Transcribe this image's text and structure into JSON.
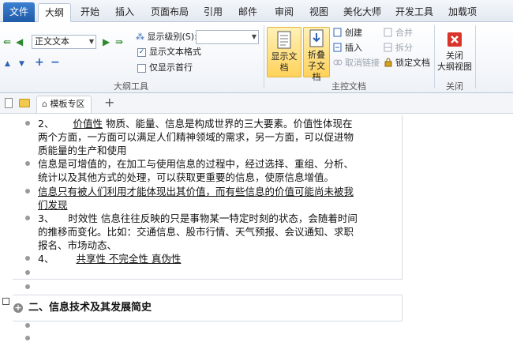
{
  "tabs": [
    {
      "label": "文件"
    },
    {
      "label": "大纲"
    },
    {
      "label": "开始"
    },
    {
      "label": "插入"
    },
    {
      "label": "页面布局"
    },
    {
      "label": "引用"
    },
    {
      "label": "邮件"
    },
    {
      "label": "审阅"
    },
    {
      "label": "视图"
    },
    {
      "label": "美化大师"
    },
    {
      "label": "开发工具"
    },
    {
      "label": "加载项"
    }
  ],
  "outline_tools": {
    "level_select": "正文文本",
    "show_level_label": "显示级别(S):",
    "show_level_value": "",
    "show_text_format_label": "显示文本格式",
    "show_text_format_checked": true,
    "first_line_only_label": "仅显示首行",
    "first_line_only_checked": false,
    "group_label": "大纲工具"
  },
  "master_doc": {
    "show_doc": "显示文档",
    "collapse_sub": "折叠\n子文档",
    "create": "创建",
    "insert": "插入",
    "unlink": "取消链接",
    "merge": "合并",
    "split": "拆分",
    "lock_doc": "锁定文档",
    "group_label": "主控文档"
  },
  "close": {
    "label": "关闭\n大纲视图",
    "group_label": "关闭"
  },
  "doc_tabs": {
    "template_zone": "模板专区"
  },
  "content": {
    "p1_num": "2、",
    "p1_term": "价值性",
    "p1_rest": "  物质、能量、信息是构成世界的三大要素。价值性体现在",
    "p1_l2": "两个方面，一方面可以满足人们精神领域的需求，另一方面，可以促进物",
    "p1_l3": "质能量的生产和使用",
    "p2_l1": "信息是可增值的，在加工与使用信息的过程中，经过选择、重组、分析、",
    "p2_l2": "统计以及其他方式的处理，可以获取更重要的信息，使原信息增值。",
    "p3_l1": "信息只有被人们利用才能体现出其价值，而有些信息的价值可能尚未被我",
    "p3_l2": "们发现",
    "p4_num": "3、",
    "p4_l1": "  时效性 信息往往反映的只是事物某一特定时刻的状态，会随着时间",
    "p4_l2": "的推移而变化。比如：交通信息、股市行情、天气预报、会议通知、求职",
    "p4_l3": "报名、市场动态、",
    "p5_num": "4、",
    "p5_term": "共享性  不完全性  真伪性",
    "heading": "二、信息技术及其发展简史"
  }
}
